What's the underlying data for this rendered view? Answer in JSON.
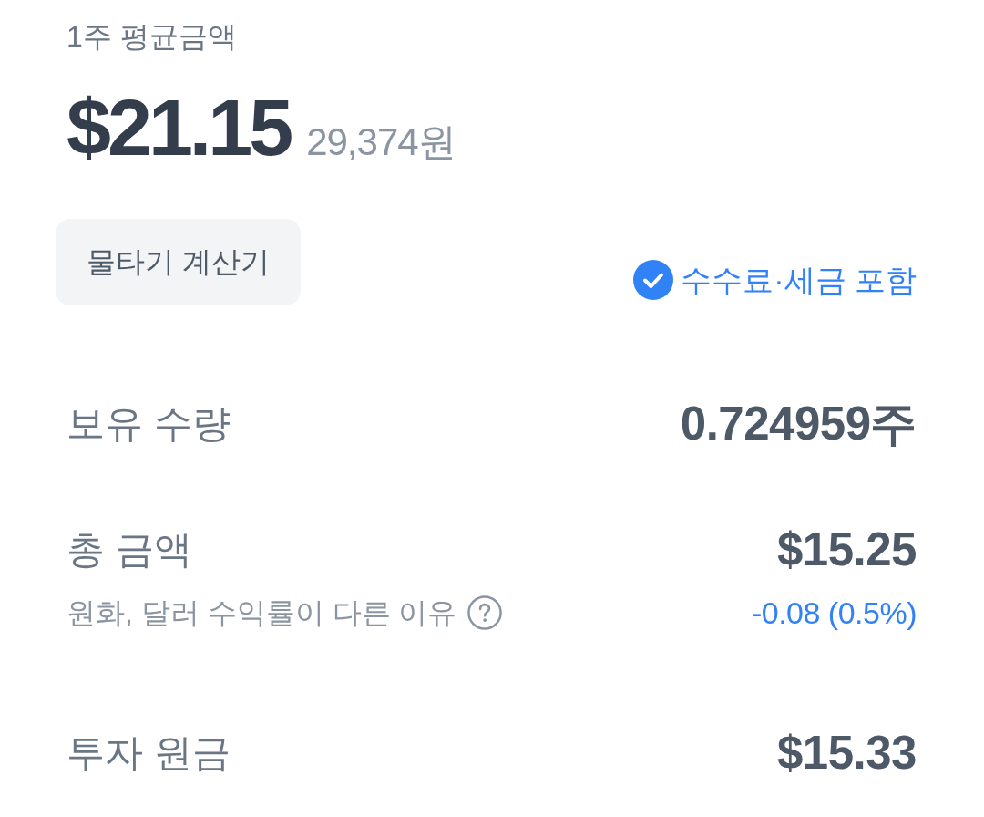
{
  "header": {
    "label": "1주 평균금액",
    "price": "$21.15",
    "price_krw": "29,374원"
  },
  "calculator_button": {
    "label": "물타기 계산기"
  },
  "fee_toggle": {
    "label": "수수료·세금 포함",
    "checked": true
  },
  "rows": [
    {
      "label": "보유 수량",
      "value": "0.724959주"
    },
    {
      "label": "총 금액",
      "value": "$15.25",
      "note": "원화, 달러 수익률이 다른 이유",
      "change": "-0.08 (0.5%)"
    },
    {
      "label": "투자 원금",
      "value": "$15.33"
    }
  ]
}
